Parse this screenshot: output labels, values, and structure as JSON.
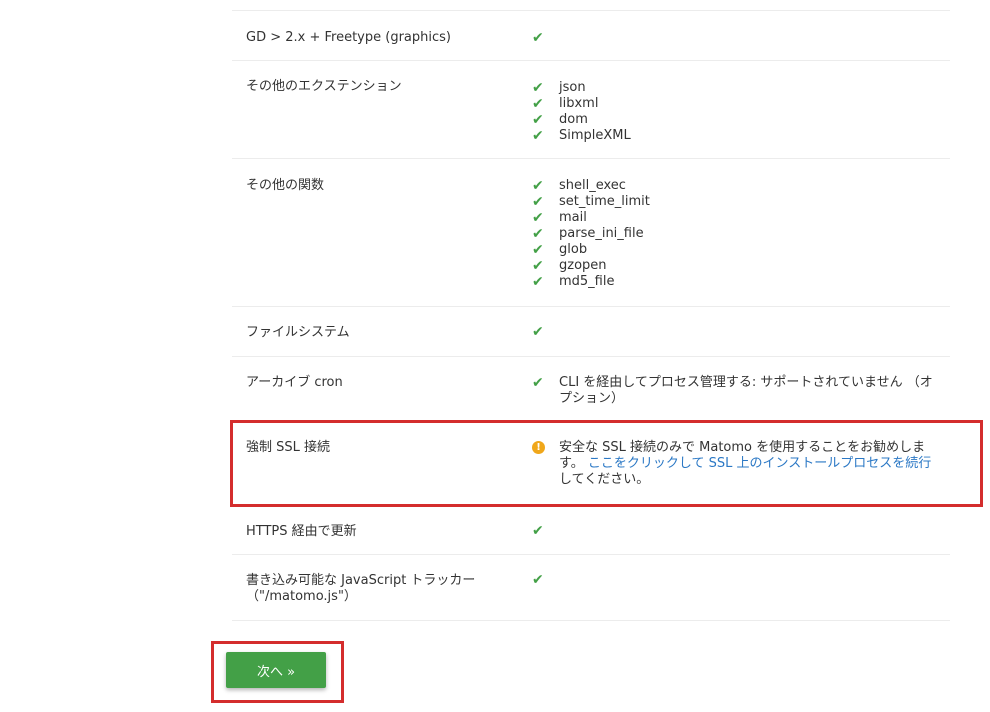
{
  "rows": [
    {
      "label": "GD > 2.x + Freetype (graphics)",
      "items": [
        ""
      ]
    },
    {
      "label": "その他のエクステンション",
      "items": [
        "json",
        "libxml",
        "dom",
        "SimpleXML"
      ]
    },
    {
      "label": "その他の関数",
      "items": [
        "shell_exec",
        "set_time_limit",
        "mail",
        "parse_ini_file",
        "glob",
        "gzopen",
        "md5_file"
      ]
    },
    {
      "label": "ファイルシステム",
      "items": [
        ""
      ]
    },
    {
      "label": "アーカイブ cron",
      "items": [
        "CLI を経由してプロセス管理する: サポートされていません （オプション）"
      ]
    }
  ],
  "ssl_row": {
    "label": "強制 SSL 接続",
    "warning_text": "安全な SSL 接続のみで Matomo を使用することをお勧めします。",
    "link_text": "ここをクリックして SSL 上のインストールプロセスを続行",
    "after_text": "してください。"
  },
  "rows_after": [
    {
      "label": "HTTPS 経由で更新",
      "items": [
        ""
      ]
    },
    {
      "label": "書き込み可能な JavaScript トラッカー（\"/matomo.js\"）",
      "items": [
        ""
      ]
    }
  ],
  "icons": {
    "check": "check-icon",
    "warning": "warning-icon"
  },
  "colors": {
    "check": "#43a047",
    "warning": "#f0a71a",
    "link": "#2b78c5",
    "highlight": "#d42d2d",
    "button": "#43a047"
  },
  "next_button": {
    "label": "次へ »"
  }
}
